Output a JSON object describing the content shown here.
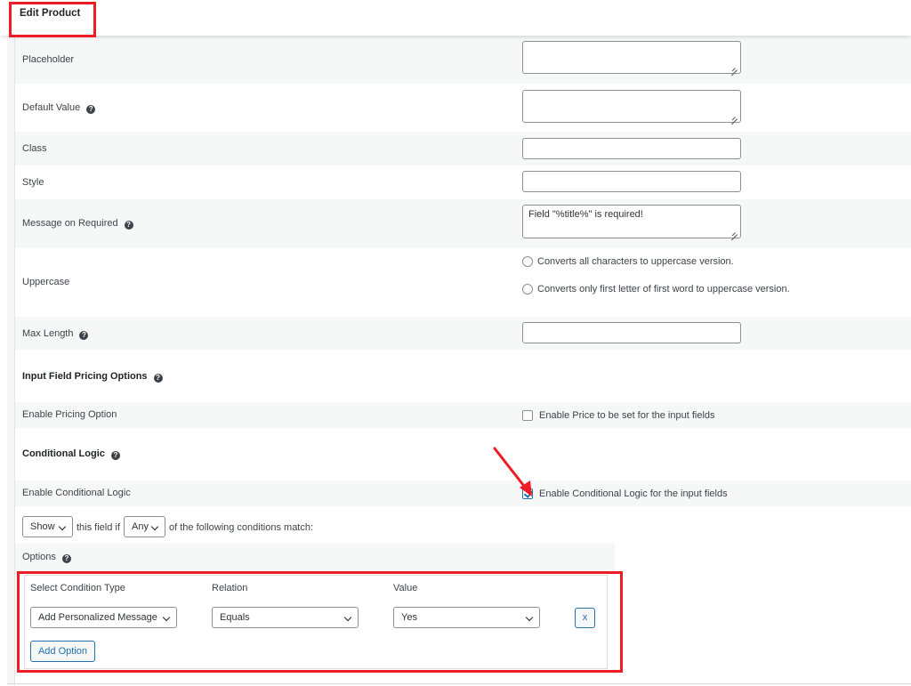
{
  "header": {
    "title": "Edit Product"
  },
  "fields": {
    "placeholder": {
      "label": "Placeholder",
      "value": ""
    },
    "default_value": {
      "label": "Default Value",
      "value": ""
    },
    "class": {
      "label": "Class",
      "value": ""
    },
    "style": {
      "label": "Style",
      "value": ""
    },
    "message_required": {
      "label": "Message on Required",
      "value": "Field \"%title%\" is required!"
    },
    "uppercase": {
      "label": "Uppercase",
      "options": [
        "Converts all characters to uppercase version.",
        "Converts only first letter of first word to uppercase version."
      ]
    },
    "max_length": {
      "label": "Max Length",
      "value": ""
    }
  },
  "pricing": {
    "section_title": "Input Field Pricing Options",
    "enable_label": "Enable Pricing Option",
    "checkbox_label": "Enable Price to be set for the input fields",
    "checked": false
  },
  "conditional": {
    "section_title": "Conditional Logic",
    "enable_label": "Enable Conditional Logic",
    "checkbox_label": "Enable Conditional Logic for the input fields",
    "checked": true,
    "show_select": "Show",
    "text_1": "this field if",
    "any_select": "Any",
    "text_2": "of the following conditions match:"
  },
  "options": {
    "title": "Options",
    "columns": [
      "Select Condition Type",
      "Relation",
      "Value"
    ],
    "row": {
      "condition_type": "Add Personalized Message",
      "relation": "Equals",
      "value": "Yes"
    },
    "remove_label": "x",
    "add_label": "Add Option"
  }
}
